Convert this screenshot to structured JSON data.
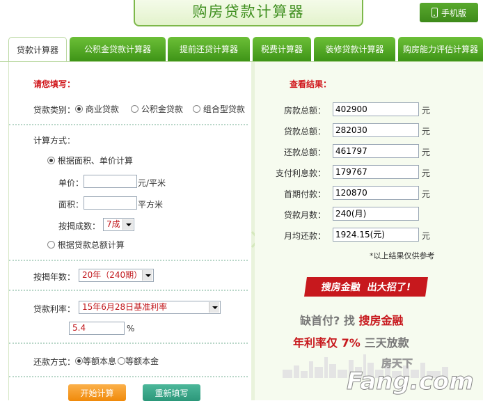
{
  "header": {
    "title": "购房贷款计算器",
    "mobile_label": "手机版"
  },
  "tabs": [
    {
      "label": "贷款计算器",
      "active": true
    },
    {
      "label": "公积金贷款计算器",
      "active": false
    },
    {
      "label": "提前还贷计算器",
      "active": false
    },
    {
      "label": "税费计算器",
      "active": false
    },
    {
      "label": "装修贷款计算器",
      "active": false
    },
    {
      "label": "购房能力评估计算器",
      "active": false
    }
  ],
  "form": {
    "heading": "请您填写：",
    "loan_type_label": "贷款类别：",
    "loan_types": [
      {
        "label": "商业贷款",
        "selected": true
      },
      {
        "label": "公积金贷款",
        "selected": false
      },
      {
        "label": "组合型贷款",
        "selected": false
      }
    ],
    "calc_method_label": "计算方式：",
    "method_area": "根据面积、单价计算",
    "unit_price_label": "单价：",
    "unit_price_value": "",
    "unit_price_unit": "元/平米",
    "area_label": "面积：",
    "area_value": "",
    "area_unit": "平方米",
    "ratio_label": "按揭成数：",
    "ratio_value": "7成",
    "method_total": "根据贷款总额计算",
    "years_label": "按揭年数：",
    "years_value": "20年（240期）",
    "rate_label": "贷款利率：",
    "rate_select": "15年6月28日基准利率",
    "rate_value": "5.4",
    "rate_unit": "%",
    "repay_label": "还款方式：",
    "repay_options": [
      {
        "label": "等额本息",
        "selected": true
      },
      {
        "label": "等额本金",
        "selected": false
      }
    ],
    "start_button": "开始计算",
    "reset_button": "重新填写"
  },
  "results": {
    "heading": "查看结果：",
    "rows": [
      {
        "label": "房款总额：",
        "value": "402900",
        "unit": "元"
      },
      {
        "label": "贷款总额：",
        "value": "282030",
        "unit": "元"
      },
      {
        "label": "还款总额：",
        "value": "461797",
        "unit": "元"
      },
      {
        "label": "支付利息款：",
        "value": "179767",
        "unit": "元"
      },
      {
        "label": "首期付款：",
        "value": "120870",
        "unit": "元"
      },
      {
        "label": "贷款月数：",
        "value": "240(月)",
        "unit": ""
      },
      {
        "label": "月均还款：",
        "value": "1924.15(元)",
        "unit": "元"
      }
    ],
    "note": "*以上结果仅供参考"
  },
  "ad": {
    "banner_left": "搜房金融",
    "banner_right": "出大招了!",
    "line1_grey_a": "缺首付?",
    "line1_grey_b": "找",
    "line1_red": "搜房金融",
    "line2_red": "年利率仅 7%",
    "line2_grey": "三天放款"
  },
  "watermark": {
    "top": "房天下",
    "main": "Fang.com"
  },
  "colors": {
    "brand_green": "#4aa123",
    "heading_red": "#d0161b",
    "panel_right_bg": "#f6fbef"
  }
}
